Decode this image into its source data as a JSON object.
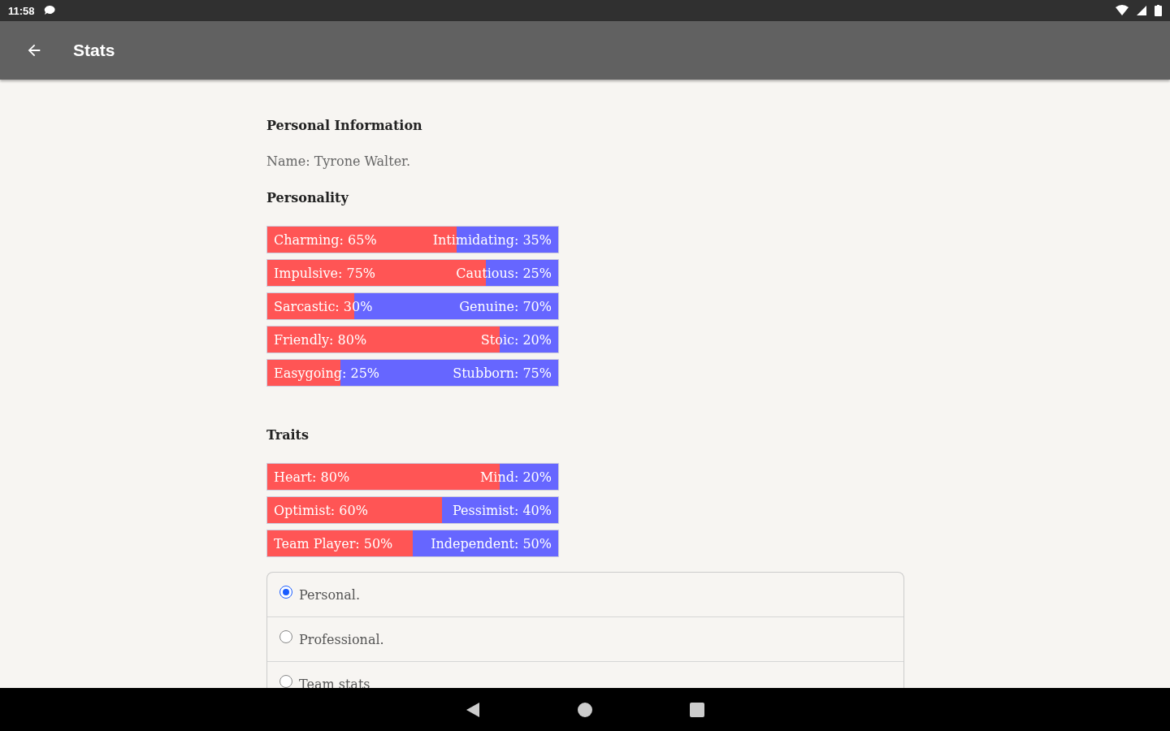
{
  "status_bar": {
    "time": "11:58"
  },
  "app_bar": {
    "title": "Stats"
  },
  "personal_information": {
    "heading": "Personal Information",
    "name": "Name: Tyrone Walter."
  },
  "personality": {
    "heading": "Personality",
    "bars": [
      {
        "left": "Charming: 65%",
        "right": "Intimidating: 35%",
        "level": 0.65
      },
      {
        "left": "Impulsive: 75%",
        "right": "Cautious: 25%",
        "level": 0.75
      },
      {
        "left": "Sarcastic: 30%",
        "right": "Genuine: 70%",
        "level": 0.3
      },
      {
        "left": "Friendly: 80%",
        "right": "Stoic: 20%",
        "level": 0.8
      },
      {
        "left": "Easygoing: 25%",
        "right": "Stubborn: 75%",
        "level": 0.25
      }
    ]
  },
  "traits": {
    "heading": "Traits",
    "bars": [
      {
        "left": "Heart: 80%",
        "right": "Mind: 20%",
        "level": 0.8
      },
      {
        "left": "Optimist: 60%",
        "right": "Pessimist: 40%",
        "level": 0.6
      },
      {
        "left": "Team Player: 50%",
        "right": "Independent: 50%",
        "level": 0.5
      }
    ]
  },
  "options": [
    {
      "label": "Personal.",
      "selected": true
    },
    {
      "label": "Professional.",
      "selected": false
    },
    {
      "label": "Team stats",
      "selected": false
    }
  ]
}
